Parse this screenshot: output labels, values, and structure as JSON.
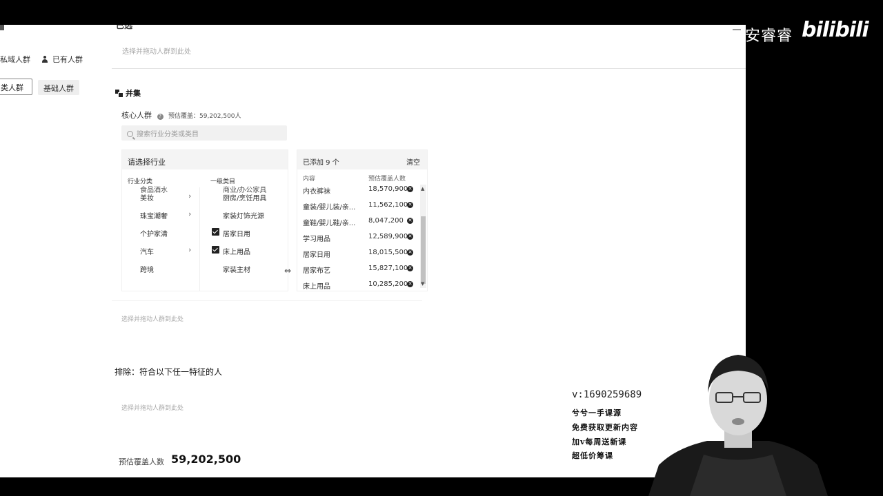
{
  "top": {
    "stub_title": "已选",
    "drop_hint": "选择并拖动人群到此处"
  },
  "left_tabs": {
    "private": "私域人群",
    "existing": "已有人群",
    "industry_btn": "类人群",
    "base_btn": "基础人群"
  },
  "union": {
    "title": "并集",
    "core_label": "核心人群",
    "coverage_text": "预估覆盖：59,202,500人",
    "search_placeholder": "搜索行业分类或类目"
  },
  "industry_panel": {
    "header": "请选择行业",
    "col_category": "行业分类",
    "col_sub": "一级类目",
    "cut_category": "食品酒水",
    "cut_sub": "商业/办公家具",
    "categories": [
      {
        "label": "美妆",
        "has_children": true
      },
      {
        "label": "珠宝潮奢",
        "has_children": true
      },
      {
        "label": "个护家清",
        "has_children": false
      },
      {
        "label": "汽车",
        "has_children": true
      },
      {
        "label": "跨境",
        "has_children": false
      }
    ],
    "subcategories": [
      {
        "label": "厨房/烹饪用具",
        "checked": false
      },
      {
        "label": "家装灯饰光源",
        "checked": false
      },
      {
        "label": "居家日用",
        "checked": true
      },
      {
        "label": "床上用品",
        "checked": true
      },
      {
        "label": "家装主材",
        "checked": false
      }
    ]
  },
  "selected_panel": {
    "header": "已添加 9 个",
    "clear": "清空",
    "col_content": "内容",
    "col_coverage": "预估覆盖人数",
    "rows": [
      {
        "name": "内衣裤袜",
        "count": "18,570,900"
      },
      {
        "name": "童装/婴儿装/亲...",
        "count": "11,562,100"
      },
      {
        "name": "童鞋/婴儿鞋/亲...",
        "count": "8,047,200"
      },
      {
        "name": "学习用品",
        "count": "12,589,900"
      },
      {
        "name": "居家日用",
        "count": "18,015,500"
      },
      {
        "name": "居家布艺",
        "count": "15,827,100"
      },
      {
        "name": "床上用品",
        "count": "10,285,200"
      }
    ]
  },
  "union_drop_hint": "选择并拖动人群到此处",
  "exclude": {
    "title": "排除：符合以下任一特征的人",
    "drop_hint": "选择并拖动人群到此处"
  },
  "total": {
    "label": "预估覆盖人数",
    "value": "59,202,500"
  },
  "watermark": {
    "name": "安睿睿",
    "logo": "bilibili"
  },
  "overlay": {
    "phone": "v:1690259689",
    "line1": "兮兮一手课源",
    "line2": "免费获取更新内容",
    "line3": "加v每周送新课",
    "line4": "超低价筹课"
  }
}
